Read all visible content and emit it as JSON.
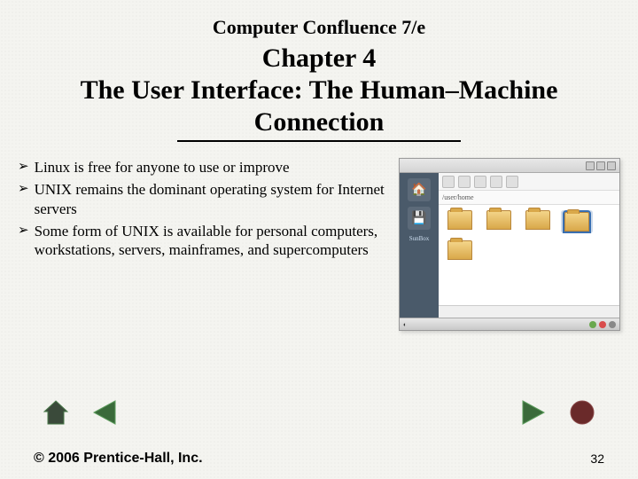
{
  "header": {
    "book_title": "Computer Confluence 7/e",
    "chapter_label": "Chapter 4",
    "chapter_title": "The User Interface: The Human–Machine Connection"
  },
  "bullets": [
    "Linux is free for anyone to use or improve",
    "UNIX remains the dominant operating system for Internet servers",
    "Some form of UNIX is available for personal computers, workstations, servers, mainframes, and supercomputers"
  ],
  "bullet_marker": "➢",
  "screenshot": {
    "sidebar_label": "SunBox",
    "address": "/user/home",
    "folder_count": 5,
    "selected_index": 3,
    "taskbar_left": "◐",
    "tray_colors": [
      "#6aa84f",
      "#d94c4c",
      "#888"
    ]
  },
  "nav": {
    "icons": {
      "home": "home",
      "prev": "previous",
      "next": "next",
      "end": "end"
    }
  },
  "footer": {
    "copyright": "© 2006 Prentice-Hall, Inc.",
    "page_number": "32"
  }
}
